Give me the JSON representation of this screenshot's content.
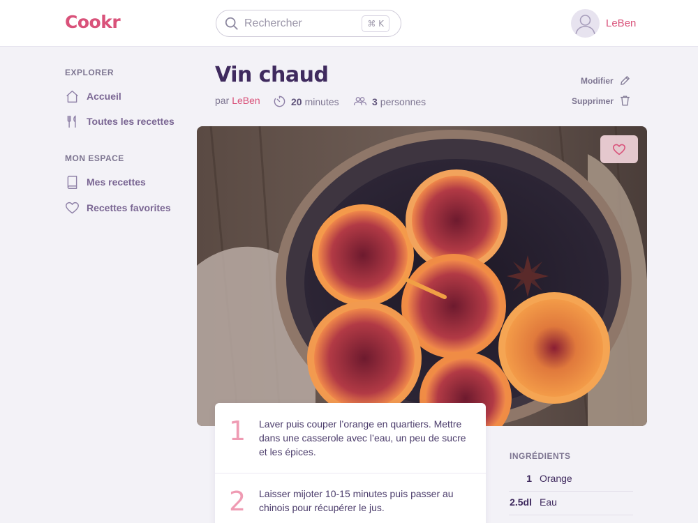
{
  "app": {
    "logo": "Cookr",
    "username": "LeBen"
  },
  "search": {
    "placeholder": "Rechercher",
    "shortcut": "⌘ K"
  },
  "sidebar": {
    "sections": [
      {
        "heading": "EXPLORER",
        "items": [
          {
            "label": "Accueil",
            "icon": "home-icon"
          },
          {
            "label": "Toutes les recettes",
            "icon": "fork-knife-icon"
          }
        ]
      },
      {
        "heading": "MON ESPACE",
        "items": [
          {
            "label": "Mes recettes",
            "icon": "book-icon"
          },
          {
            "label": "Recettes favorites",
            "icon": "heart-icon"
          }
        ]
      }
    ]
  },
  "recipe": {
    "title": "Vin chaud",
    "by_prefix": "par",
    "author": "LeBen",
    "time_value": "20",
    "time_unit": "minutes",
    "people_value": "3",
    "people_unit": "personnes",
    "edit_label": "Modifier",
    "delete_label": "Supprimer"
  },
  "steps": [
    {
      "number": "1",
      "text": "Laver puis couper l’orange en quartiers. Mettre dans une casserole avec l’eau, un peu de sucre et les épices."
    },
    {
      "number": "2",
      "text": "Laisser mijoter 10-15 minutes puis passer au chinois pour récupérer le jus."
    }
  ],
  "ingredients": {
    "heading": "INGRÉDIENTS",
    "items": [
      {
        "quantity": "1",
        "name": "Orange"
      },
      {
        "quantity": "2.5dl",
        "name": "Eau"
      }
    ]
  },
  "colors": {
    "accent": "#d9527a",
    "title": "#3f2a5e",
    "background": "#f3f2f7"
  }
}
